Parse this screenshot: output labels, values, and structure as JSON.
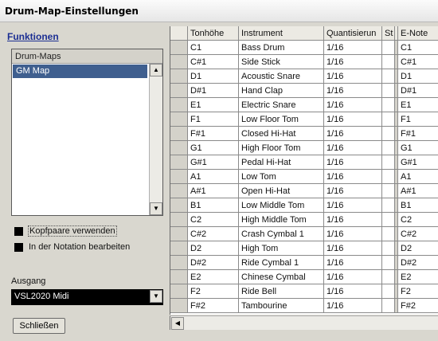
{
  "window": {
    "title": "Drum-Map-Einstellungen"
  },
  "left_panel": {
    "functions_heading": "Funktionen",
    "drum_maps_header": "Drum-Maps",
    "drum_maps": [
      "GM Map"
    ],
    "options": [
      {
        "label": "Kopfpaare verwenden",
        "checked": true
      },
      {
        "label": "In der Notation bearbeiten",
        "checked": true
      }
    ],
    "output_label": "Ausgang",
    "output_value": "VSL2020 Midi",
    "close_button": "Schließen"
  },
  "grid": {
    "columns": [
      "Tonhöhe",
      "Instrument",
      "Quantisierun",
      "St",
      "E-Note"
    ],
    "rows": [
      {
        "pitch": "C1",
        "instrument": "Bass Drum",
        "quant": "1/16",
        "enote": "C1"
      },
      {
        "pitch": "C#1",
        "instrument": "Side Stick",
        "quant": "1/16",
        "enote": "C#1"
      },
      {
        "pitch": "D1",
        "instrument": "Acoustic Snare",
        "quant": "1/16",
        "enote": "D1"
      },
      {
        "pitch": "D#1",
        "instrument": "Hand Clap",
        "quant": "1/16",
        "enote": "D#1"
      },
      {
        "pitch": "E1",
        "instrument": "Electric Snare",
        "quant": "1/16",
        "enote": "E1"
      },
      {
        "pitch": "F1",
        "instrument": "Low Floor Tom",
        "quant": "1/16",
        "enote": "F1"
      },
      {
        "pitch": "F#1",
        "instrument": "Closed Hi-Hat",
        "quant": "1/16",
        "enote": "F#1"
      },
      {
        "pitch": "G1",
        "instrument": "High Floor Tom",
        "quant": "1/16",
        "enote": "G1"
      },
      {
        "pitch": "G#1",
        "instrument": "Pedal Hi-Hat",
        "quant": "1/16",
        "enote": "G#1"
      },
      {
        "pitch": "A1",
        "instrument": "Low Tom",
        "quant": "1/16",
        "enote": "A1"
      },
      {
        "pitch": "A#1",
        "instrument": "Open Hi-Hat",
        "quant": "1/16",
        "enote": "A#1"
      },
      {
        "pitch": "B1",
        "instrument": "Low Middle Tom",
        "quant": "1/16",
        "enote": "B1"
      },
      {
        "pitch": "C2",
        "instrument": "High Middle Tom",
        "quant": "1/16",
        "enote": "C2"
      },
      {
        "pitch": "C#2",
        "instrument": "Crash Cymbal 1",
        "quant": "1/16",
        "enote": "C#2"
      },
      {
        "pitch": "D2",
        "instrument": "High Tom",
        "quant": "1/16",
        "enote": "D2"
      },
      {
        "pitch": "D#2",
        "instrument": "Ride Cymbal 1",
        "quant": "1/16",
        "enote": "D#2"
      },
      {
        "pitch": "E2",
        "instrument": "Chinese Cymbal",
        "quant": "1/16",
        "enote": "E2"
      },
      {
        "pitch": "F2",
        "instrument": "Ride Bell",
        "quant": "1/16",
        "enote": "F2"
      },
      {
        "pitch": "F#2",
        "instrument": "Tambourine",
        "quant": "1/16",
        "enote": "F#2"
      }
    ]
  },
  "icons": {
    "scroll_up": "▲",
    "scroll_down": "▼",
    "scroll_left": "◀",
    "dropdown": "▼"
  },
  "colors": {
    "selection": "#3f5f8f",
    "heading_link": "#1c2f93",
    "background": "#d9d7cf"
  }
}
